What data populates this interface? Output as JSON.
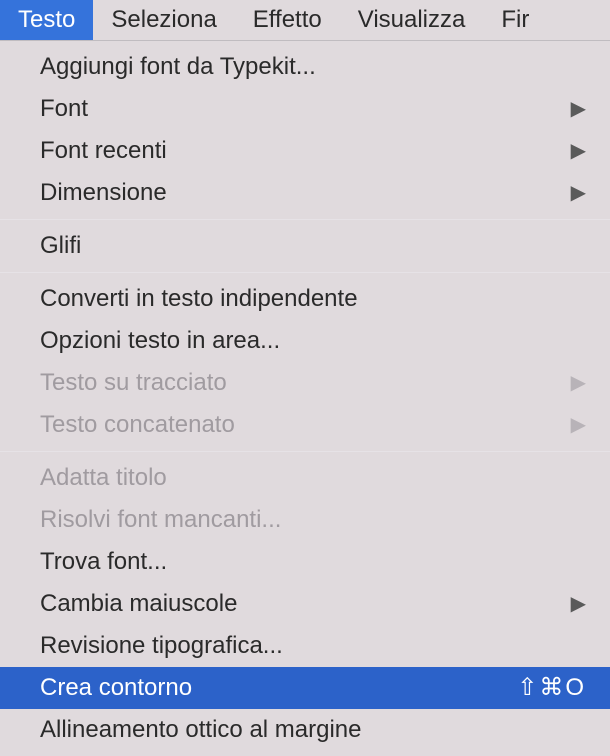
{
  "menubar": {
    "items": [
      {
        "label": "Testo",
        "active": true
      },
      {
        "label": "Seleziona",
        "active": false
      },
      {
        "label": "Effetto",
        "active": false
      },
      {
        "label": "Visualizza",
        "active": false
      },
      {
        "label": "Fir",
        "active": false
      }
    ]
  },
  "menu": {
    "groups": [
      {
        "items": [
          {
            "label": "Aggiungi font da Typekit...",
            "submenu": false,
            "disabled": false,
            "highlighted": false,
            "shortcut": ""
          },
          {
            "label": "Font",
            "submenu": true,
            "disabled": false,
            "highlighted": false,
            "shortcut": ""
          },
          {
            "label": "Font recenti",
            "submenu": true,
            "disabled": false,
            "highlighted": false,
            "shortcut": ""
          },
          {
            "label": "Dimensione",
            "submenu": true,
            "disabled": false,
            "highlighted": false,
            "shortcut": ""
          }
        ]
      },
      {
        "items": [
          {
            "label": "Glifi",
            "submenu": false,
            "disabled": false,
            "highlighted": false,
            "shortcut": ""
          }
        ]
      },
      {
        "items": [
          {
            "label": "Converti in testo indipendente",
            "submenu": false,
            "disabled": false,
            "highlighted": false,
            "shortcut": ""
          },
          {
            "label": "Opzioni testo in area...",
            "submenu": false,
            "disabled": false,
            "highlighted": false,
            "shortcut": ""
          },
          {
            "label": "Testo su tracciato",
            "submenu": true,
            "disabled": true,
            "highlighted": false,
            "shortcut": ""
          },
          {
            "label": "Testo concatenato",
            "submenu": true,
            "disabled": true,
            "highlighted": false,
            "shortcut": ""
          }
        ]
      },
      {
        "items": [
          {
            "label": "Adatta titolo",
            "submenu": false,
            "disabled": true,
            "highlighted": false,
            "shortcut": ""
          },
          {
            "label": "Risolvi font mancanti...",
            "submenu": false,
            "disabled": true,
            "highlighted": false,
            "shortcut": ""
          },
          {
            "label": "Trova font...",
            "submenu": false,
            "disabled": false,
            "highlighted": false,
            "shortcut": ""
          },
          {
            "label": "Cambia maiuscole",
            "submenu": true,
            "disabled": false,
            "highlighted": false,
            "shortcut": ""
          },
          {
            "label": "Revisione tipografica...",
            "submenu": false,
            "disabled": false,
            "highlighted": false,
            "shortcut": ""
          },
          {
            "label": "Crea contorno",
            "submenu": false,
            "disabled": false,
            "highlighted": true,
            "shortcut": "⇧⌘O"
          },
          {
            "label": "Allineamento ottico al margine",
            "submenu": false,
            "disabled": false,
            "highlighted": false,
            "shortcut": ""
          }
        ]
      }
    ]
  }
}
